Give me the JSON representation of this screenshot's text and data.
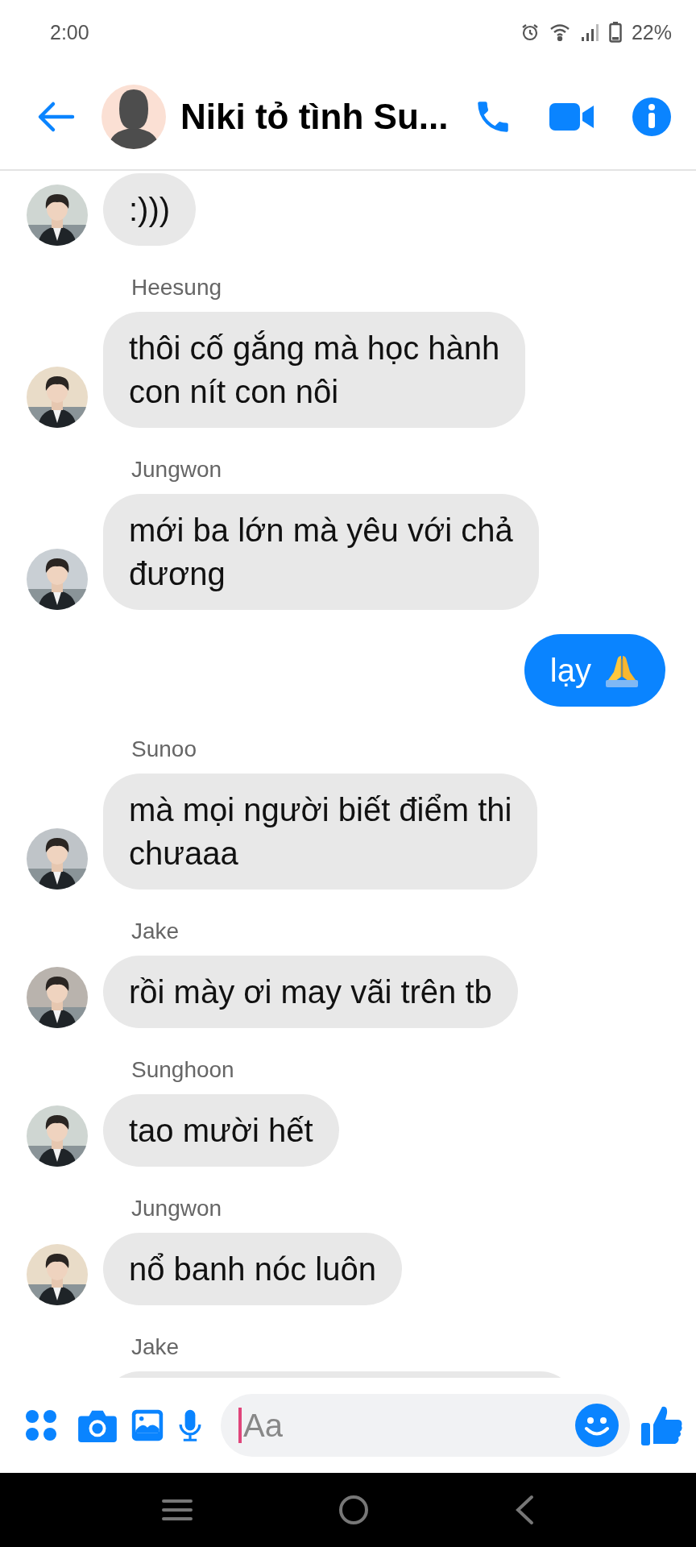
{
  "status_bar": {
    "time": "2:00",
    "battery": "22%"
  },
  "header": {
    "title": "Niki tỏ tình Su..."
  },
  "messages": [
    {
      "kind": "in",
      "text": ":)))",
      "avatar": true
    },
    {
      "kind": "in",
      "sender": "Heesung",
      "text": "thôi cố gắng mà học hành\ncon nít con nôi",
      "avatar": true
    },
    {
      "kind": "in",
      "sender": "Jungwon",
      "text": "mới ba lớn mà yêu với chả\nđương",
      "avatar": true
    },
    {
      "kind": "out",
      "text": "lạy",
      "avatar": false
    },
    {
      "kind": "in",
      "sender": "Sunoo",
      "text": "mà mọi người biết điểm thi\nchưaaa",
      "avatar": true
    },
    {
      "kind": "in",
      "sender": "Jake",
      "text": "rồi mày ơi may vãi trên tb",
      "avatar": true
    },
    {
      "kind": "in",
      "sender": "Sunghoon",
      "text": "tao mười hết",
      "avatar": true
    },
    {
      "kind": "in",
      "sender": "Jungwon",
      "text": "nổ banh nóc luôn",
      "avatar": true
    },
    {
      "kind": "in",
      "sender": "Jake",
      "avatar": false
    }
  ],
  "composer": {
    "placeholder": "Aa"
  }
}
